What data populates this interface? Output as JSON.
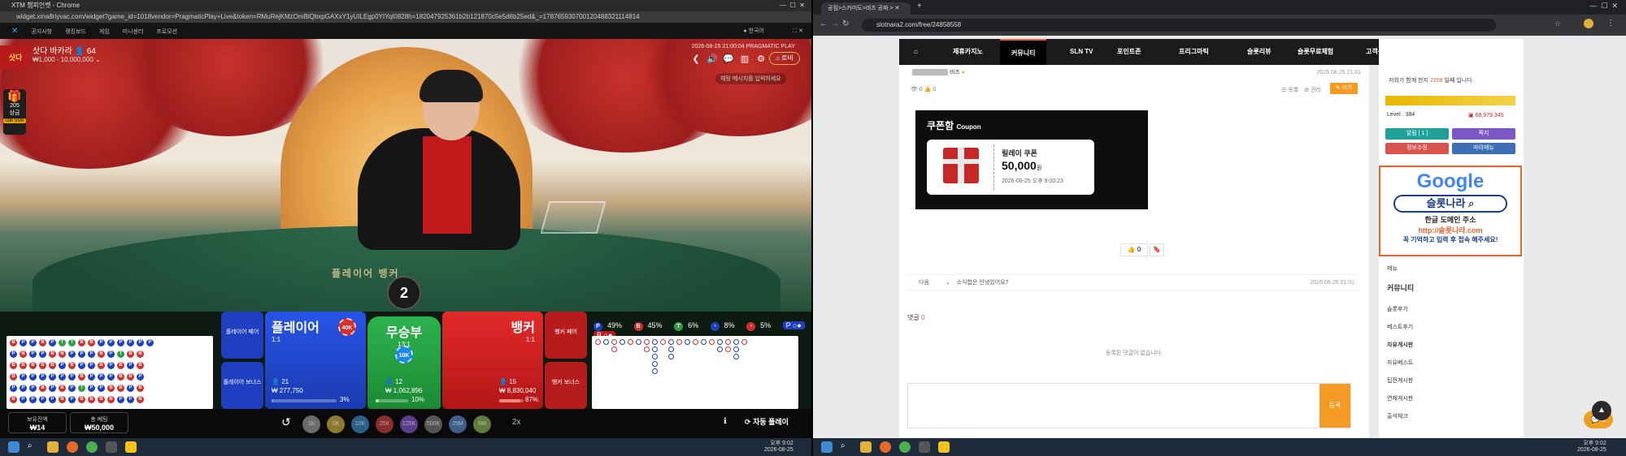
{
  "left": {
    "window_title": "XTM 챔피언벳 - Chrome",
    "url": "widget.xma8riyvac.com/widget?game_id=1018vendor=PragmaticPlay+Live&token=RMuRejKMzOmBlQbxpGAXxY1yUILEgp0YIYqI0828h=182047925361b2b121870c5e5d6b25ed&_=178765930700120488321114814",
    "nav": [
      "공지사항",
      "랭킹보드",
      "게임",
      "미니센터",
      "프로모션"
    ],
    "table_tag": "삿다",
    "game_title": "삿다 바카라",
    "players": "64",
    "bet_range": "₩1,000 - 10,000,000",
    "round_id": "2026-08-25 21:00:04",
    "provider": "PRAGMATIC PLAY",
    "lobby_label": "로비",
    "chat_placeholder": "채팅 메시지를 입력하세요",
    "side_app_count": "205",
    "side_app_label": "상금",
    "side_app_badge": "03h 55m",
    "round_number": "2",
    "table_print": "플레이어  뱅커",
    "stats": {
      "p": "49%",
      "b": "45%",
      "t": "6%",
      "pp": "8%",
      "bp": "5%"
    },
    "bets": {
      "player_pair": "플레이어 페어",
      "player_bonus": "플레이어 보너스",
      "player": "플레이어",
      "player_odds": "1:1",
      "player_players": "21",
      "player_amount": "₩ 277,750",
      "player_pct": "3%",
      "tie": "무승부",
      "tie_odds": "13:1",
      "tie_players": "12",
      "tie_amount": "₩ 1,062,896",
      "tie_pct": "10%",
      "banker": "뱅커",
      "banker_odds": "1:1",
      "banker_players": "15",
      "banker_amount": "₩ 8,830,040",
      "banker_pct": "87%",
      "banker_pair": "뱅커 페어",
      "banker_bonus": "뱅커 보너스",
      "player_chip": "40K",
      "tie_chip": "10K",
      "player_pct_value": 3,
      "tie_pct_value": 10,
      "banker_pct_value": 87
    },
    "balance_label": "보유잔액",
    "balance_value": "₩14",
    "total_bet_label": "총 베팅",
    "total_bet_value": "₩50,000",
    "chips": [
      "1K",
      "5K",
      "10K",
      "25K",
      "125K",
      "500K",
      "25M",
      "5M"
    ],
    "multiplier": "2x",
    "autoplay": "자동 플레이",
    "beads": "BPBBPBPBBPPPPPBPPPBPBPBPPBBPPPTBPPBBTPBPPPBPPBTBBPPPPBPBBPPBPPPPBBPTBBBPPBPBPPPBBPBBP",
    "colors": {
      "player": "#1e3fbf",
      "banker": "#d32f2f",
      "tie": "#2e9e47",
      "gold": "#e0b23a"
    }
  },
  "right": {
    "tab_title": "공짐>스카미도>비즈 공짜 >",
    "url": "slotnara2.com/free/24858558",
    "nav": [
      "제휴카지노",
      "커뮤니티",
      "SLN TV",
      "포인트존",
      "프리그마틱",
      "슬롯리뷰",
      "슬롯무료체험",
      "고객센터"
    ],
    "author": "비즈",
    "post_time": "2026.08.25 21:01",
    "views": "0",
    "likes": "0",
    "list_label": "목록",
    "manage_label": "관리",
    "write_label": "쓰기",
    "coupon_title": "쿠폰함",
    "coupon_sub": "Coupon",
    "coupon_name": "릴레이 쿠폰",
    "coupon_amount": "50,000",
    "coupon_unit": "원",
    "coupon_date": "2026-08-25 오후 9:00:23",
    "vote_count": "0",
    "next_label": "다음",
    "next_title": "소식합은 안녕있어요?",
    "next_time": "2026.08.25 21:01",
    "comments_label": "댓글",
    "comments_count": "0",
    "no_comments": "등록된 댓글이 없습니다.",
    "register_label": "등록",
    "sidebar": {
      "join_text_a": "저희가 함께 한지",
      "join_days": "2258",
      "join_text_b": "일째 입니다.",
      "level": "Level . 384",
      "points": "68,979,345",
      "btn1": "알림 [ 1 ]",
      "btn2": "쪽지",
      "btn3": "정보수정",
      "btn4": "마이메뉴",
      "ad_logo": "Google",
      "ad_search": "슬롯나라",
      "ad_line1": "한글 도메인 주소",
      "ad_line2": "http://슬롯나라.com",
      "ad_line3": "꼭 기억하고 입력 후 접속 해주세요!",
      "menu_label": "메뉴",
      "community_label": "커뮤니티",
      "menu_items": [
        "슬롯후기",
        "베스트후기",
        "자유게시판",
        "자유베스트",
        "팁전게시판",
        "연재게시판",
        "출석체크"
      ]
    },
    "chat_count": "1"
  },
  "taskbar_left": {
    "time": "오후 9:02",
    "date": "2026-08-25"
  },
  "taskbar_right": {
    "time": "오후 9:02",
    "date": "2026-08-25"
  }
}
